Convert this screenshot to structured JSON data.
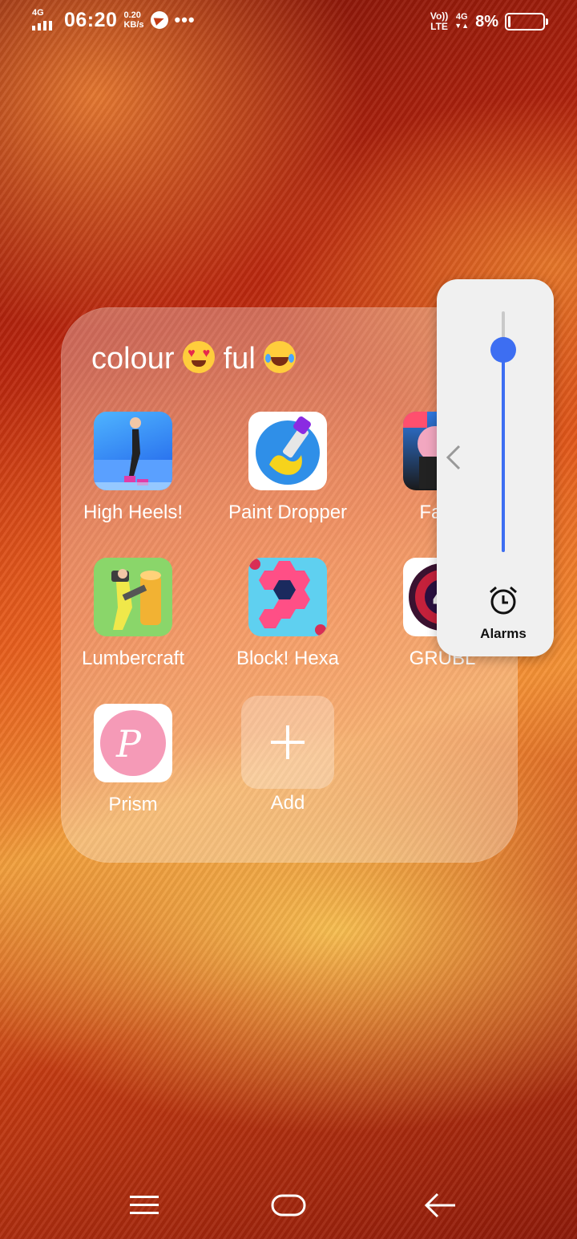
{
  "status_bar": {
    "network_type": "4G",
    "time": "06:20",
    "speed_value": "0.20",
    "speed_unit": "KB/s",
    "more": "•••",
    "volte_top": "Vo))",
    "volte_bottom": "LTE",
    "network_right": "4G",
    "battery_percent": "8%",
    "battery_level": 0.08
  },
  "folder": {
    "title": "colour",
    "title_suffix": "ful",
    "apps": [
      {
        "label": "High Heels!"
      },
      {
        "label": "Paint Dropper"
      },
      {
        "label": "Fat P"
      },
      {
        "label": "Lumbercraft"
      },
      {
        "label": "Block! Hexa"
      },
      {
        "label": "GRUBL"
      },
      {
        "label": "Prism"
      },
      {
        "label": "Add"
      }
    ]
  },
  "volume_panel": {
    "stream_label": "Alarms",
    "level": 0.84,
    "icon": "alarm-clock-icon"
  },
  "navbar": {
    "menu_icon": "menu-icon",
    "home_icon": "home-icon",
    "back_icon": "back-arrow-icon"
  },
  "colors": {
    "accent": "#3d6ef2",
    "panel_bg": "#f0f0f0"
  }
}
